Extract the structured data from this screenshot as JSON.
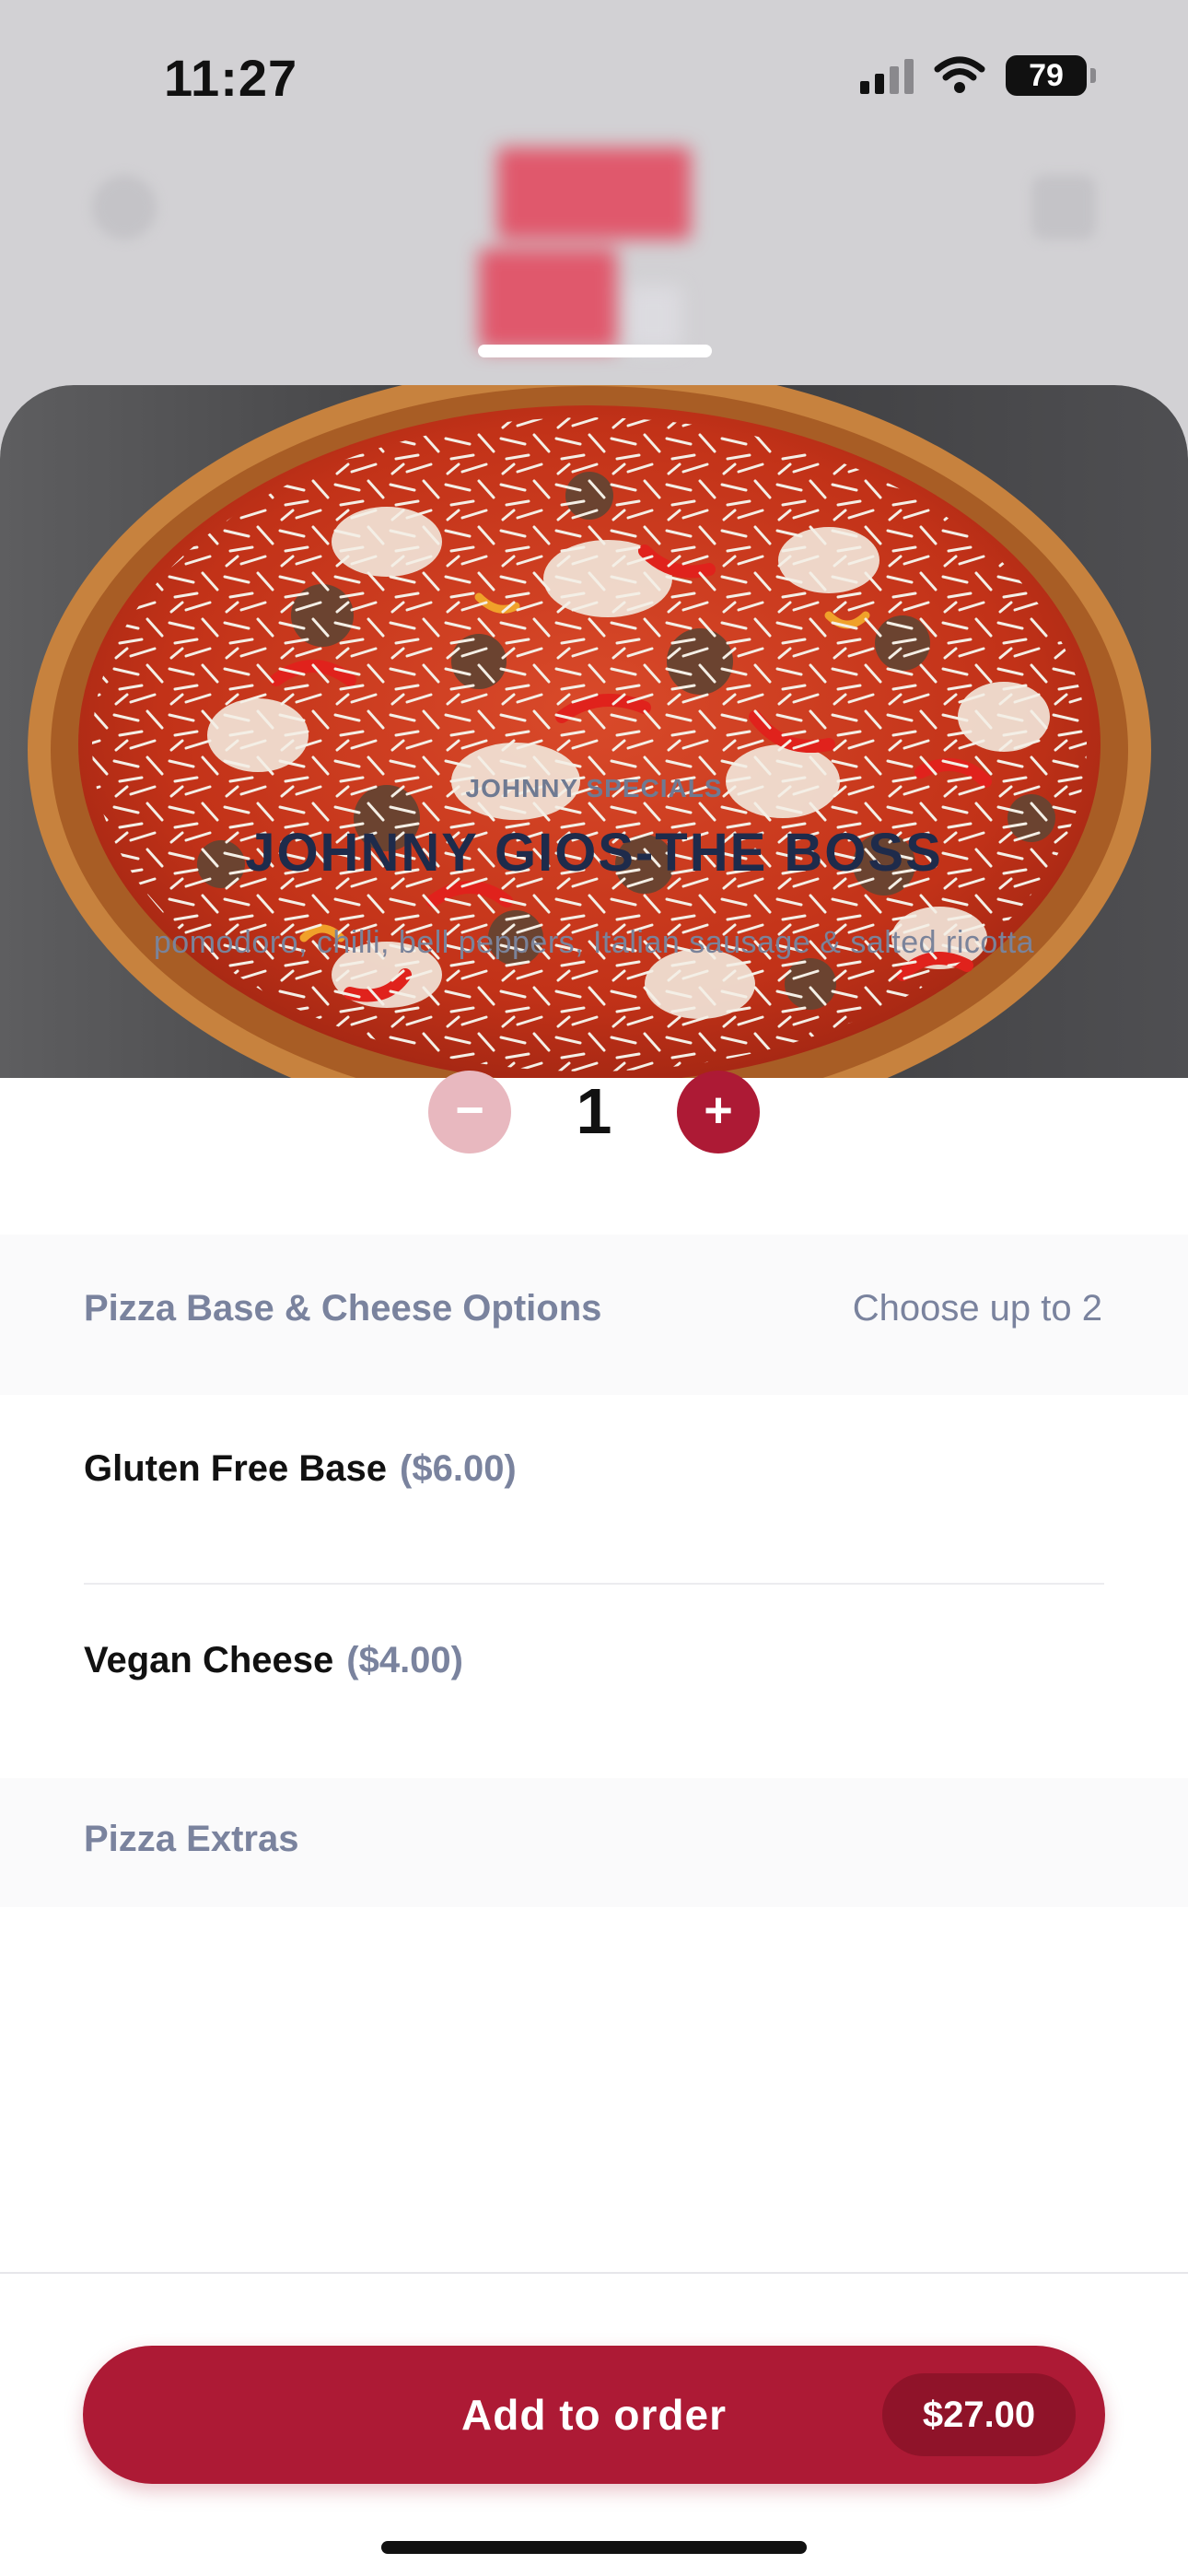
{
  "status_bar": {
    "time": "11:27",
    "battery": "79"
  },
  "item": {
    "category": "JOHNNY SPECIALS",
    "title": "JOHNNY GIOS-THE BOSS",
    "description": "pomodoro,  chilli,  bell peppers,  Italian sausage & salted ricotta"
  },
  "quantity": {
    "minus": "−",
    "value": "1",
    "plus": "+"
  },
  "sections": [
    {
      "title": "Pizza Base & Cheese Options",
      "note": "Choose up to 2",
      "options": [
        {
          "label": "Gluten Free Base",
          "price": "($6.00)"
        },
        {
          "label": "Vegan Cheese",
          "price": "($4.00)"
        }
      ]
    },
    {
      "title": "Pizza Extras"
    }
  ],
  "footer": {
    "add_label": "Add to order",
    "price": "$27.00"
  },
  "colors": {
    "accent": "#ad1a35",
    "accent_light": "#e8b8bf",
    "title": "#1e2b4b",
    "muted": "#7a839e"
  },
  "icons": [
    "signal-icon",
    "wifi-icon",
    "battery-icon",
    "minus-icon",
    "plus-icon"
  ]
}
